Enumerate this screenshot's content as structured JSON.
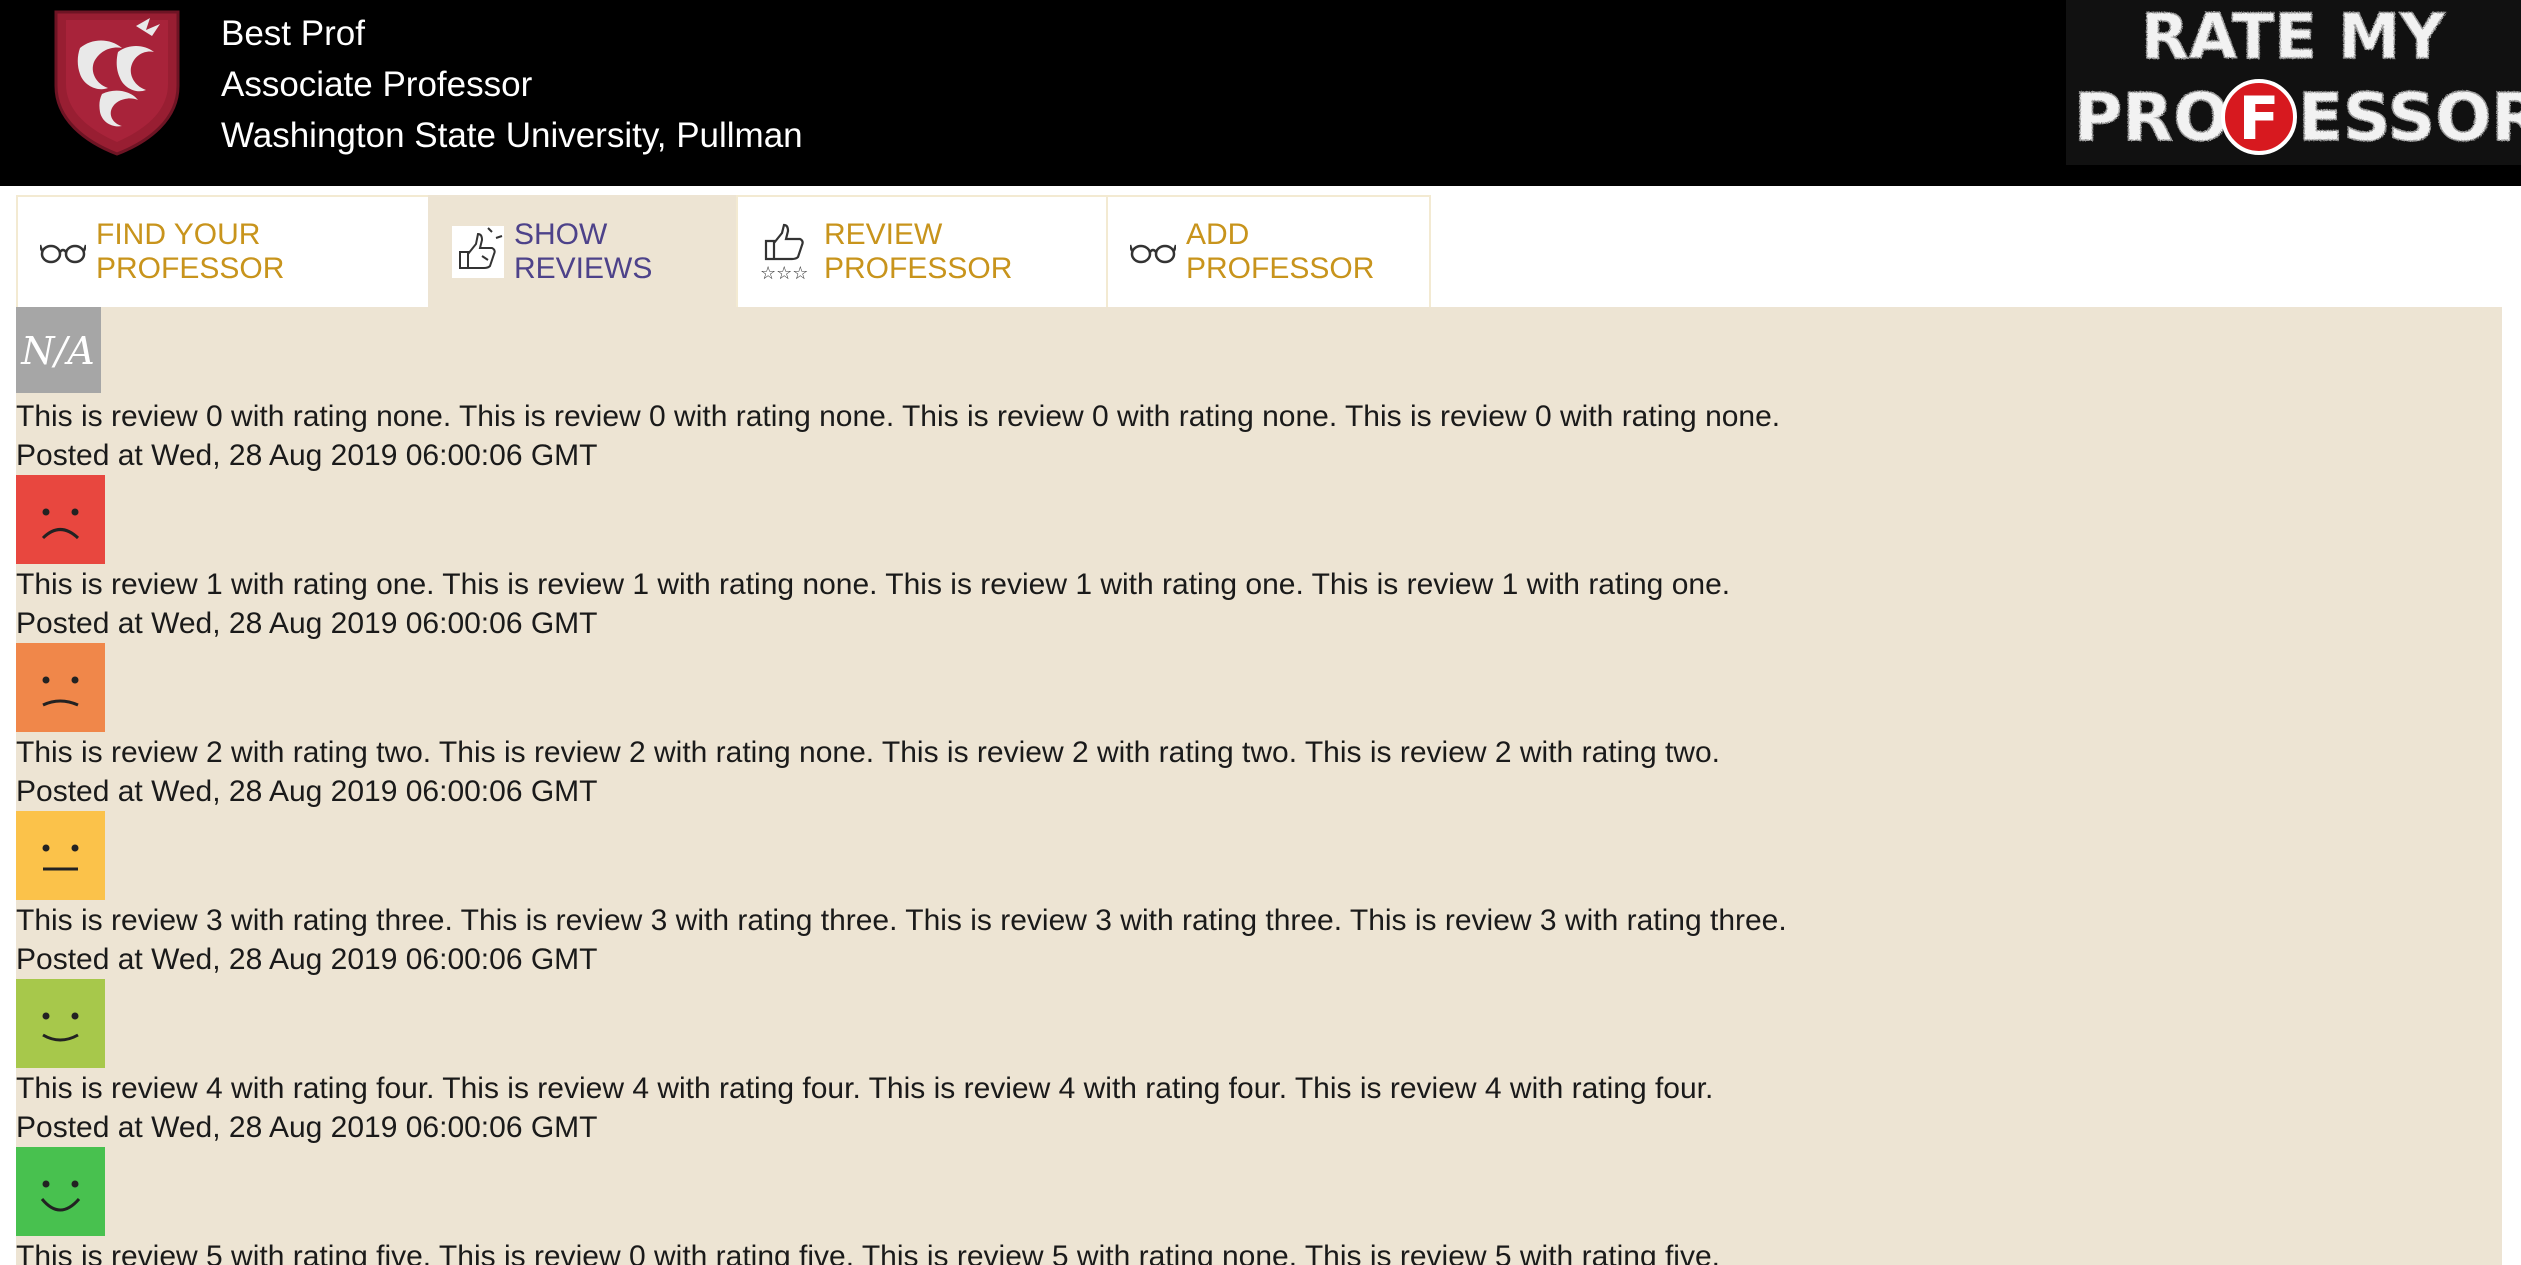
{
  "header": {
    "name": "Best Prof",
    "title": "Associate Professor",
    "university": "Washington State University, Pullman",
    "logo_icon": "wsu-cougar-shield-icon",
    "brand_line1": "RATE MY",
    "brand_line2_a": "PRO",
    "brand_line2_f": "F",
    "brand_line2_b": "ESSOR"
  },
  "tabs": [
    {
      "label": "FIND YOUR PROFESSOR",
      "icon": "glasses-icon",
      "active": false
    },
    {
      "label": "SHOW REVIEWS",
      "icon": "thumbs-up-down-icon",
      "active": true
    },
    {
      "label": "REVIEW PROFESSOR",
      "icon": "thumbs-up-stars-icon",
      "active": false
    },
    {
      "label": "ADD PROFESSOR",
      "icon": "glasses-icon",
      "active": false
    }
  ],
  "reviews": [
    {
      "rating": "none",
      "icon": "na-rating-icon",
      "color": "#a6a6a6",
      "badge": "N/A",
      "text": "This is review 0 with rating none. This is review 0 with rating none. This is review 0 with rating none. This is review 0 with rating none.",
      "date": "Posted at Wed, 28 Aug 2019 06:00:06 GMT"
    },
    {
      "rating": "one",
      "icon": "very-sad-face-icon",
      "color": "#e8473f",
      "text": "This is review 1 with rating one. This is review 1 with rating none. This is review 1 with rating one. This is review 1 with rating one.",
      "date": "Posted at Wed, 28 Aug 2019 06:00:06 GMT"
    },
    {
      "rating": "two",
      "icon": "sad-face-icon",
      "color": "#f0874a",
      "text": "This is review 2 with rating two. This is review 2 with rating none. This is review 2 with rating two. This is review 2 with rating two.",
      "date": "Posted at Wed, 28 Aug 2019 06:00:06 GMT"
    },
    {
      "rating": "three",
      "icon": "neutral-face-icon",
      "color": "#fbc24a",
      "text": "This is review 3 with rating three. This is review 3 with rating three. This is review 3 with rating three. This is review 3 with rating three.",
      "date": "Posted at Wed, 28 Aug 2019 06:00:06 GMT"
    },
    {
      "rating": "four",
      "icon": "smile-face-icon",
      "color": "#a7c84b",
      "text": "This is review 4 with rating four. This is review 4 with rating four. This is review 4 with rating four. This is review 4 with rating four.",
      "date": "Posted at Wed, 28 Aug 2019 06:00:06 GMT"
    },
    {
      "rating": "five",
      "icon": "big-smile-face-icon",
      "color": "#48c14f",
      "text": "This is review 5 with rating five. This is review 0 with rating five. This is review 5 with rating none. This is review 5 with rating five.",
      "date": ""
    }
  ]
}
